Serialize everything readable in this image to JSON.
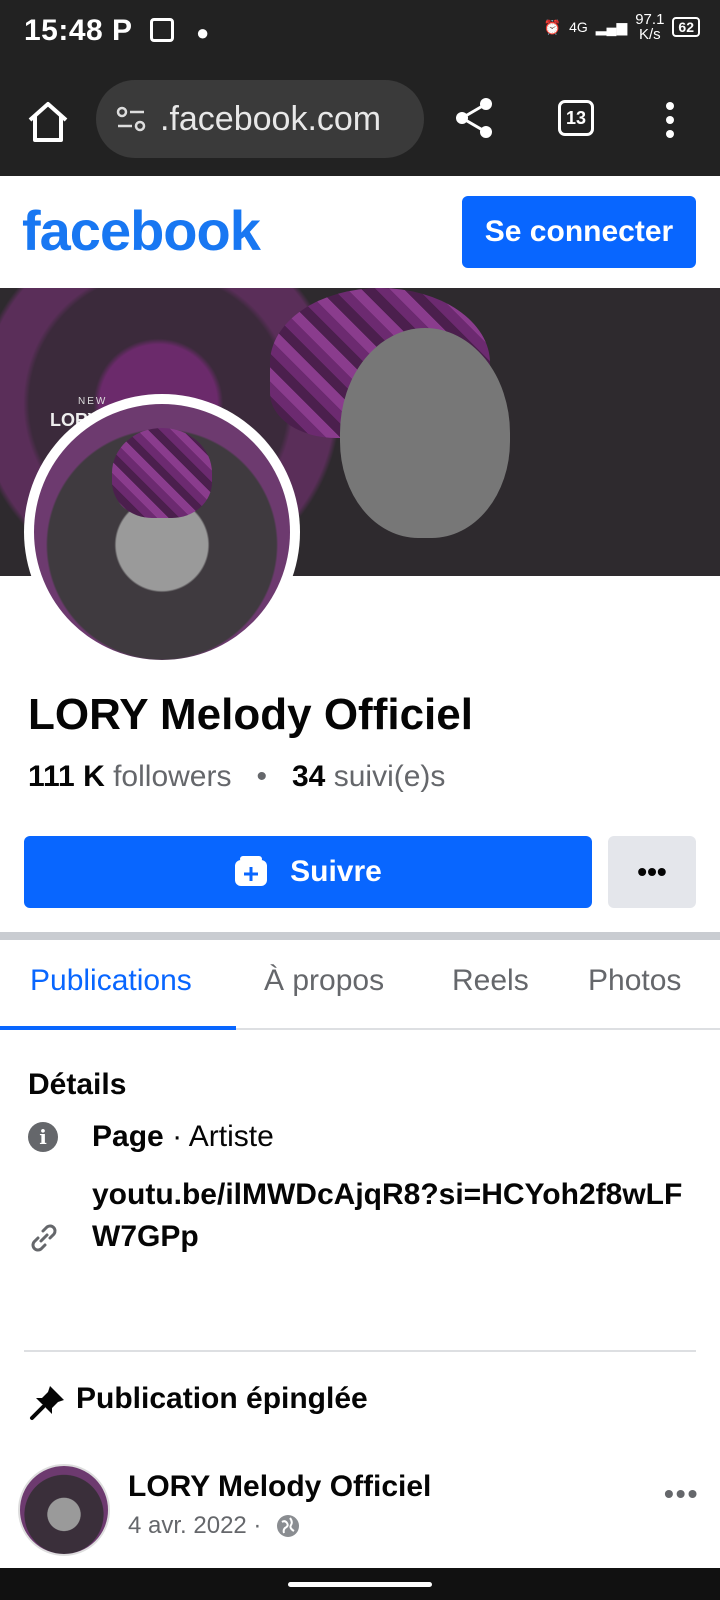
{
  "status_bar": {
    "time": "15:48",
    "notif_p": "P",
    "network_speed_value": "97.1",
    "network_speed_unit": "K/s",
    "network_type": "4G",
    "battery": "62"
  },
  "browser": {
    "url": ".facebook.com",
    "tab_count": "13"
  },
  "fb_header": {
    "logo": "facebook",
    "login_label": "Se connecter"
  },
  "cover": {
    "text_new": "NEW",
    "text_lory": "LORY MELODY"
  },
  "profile": {
    "name": "LORY Melody Officiel",
    "followers_count": "111 K",
    "followers_label": "followers",
    "following_count": "34",
    "following_label": "suivi(e)s",
    "follow_label": "Suivre",
    "more_label": "•••"
  },
  "tabs": [
    {
      "label": "Publications",
      "active": true
    },
    {
      "label": "À propos",
      "active": false
    },
    {
      "label": "Reels",
      "active": false
    },
    {
      "label": "Photos",
      "active": false
    }
  ],
  "details": {
    "title": "Détails",
    "page_label": "Page",
    "category": "· Artiste",
    "link": "youtu.be/ilMWDcAjqR8?si=HCYoh2f8wLFW7GPp"
  },
  "pinned": {
    "title": "Publication épinglée",
    "author": "LORY Melody Officiel",
    "date": "4 avr. 2022 ·",
    "more": "•••"
  },
  "colors": {
    "brand_blue": "#0866ff",
    "logo_blue": "#1877f2",
    "chrome_dark": "#222222"
  }
}
